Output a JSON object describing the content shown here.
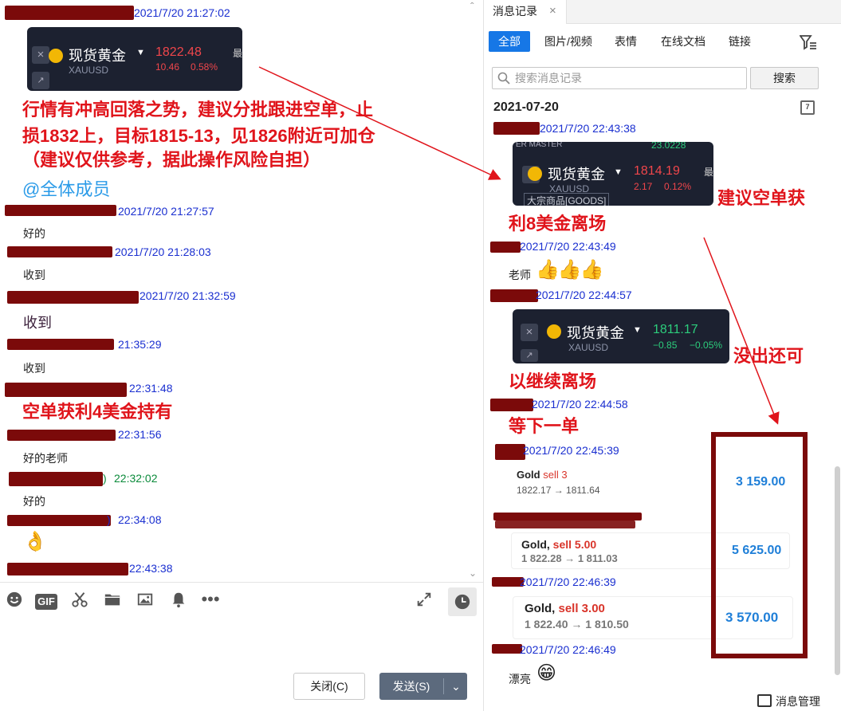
{
  "chat": {
    "entries": [
      {
        "time": "2021/7/20 21:27:02"
      },
      {
        "time": "2021/7/20 21:27:57",
        "text": "好的"
      },
      {
        "time": "2021/7/20 21:28:03",
        "text": "收到"
      },
      {
        "time": "2021/7/20 21:32:59",
        "text": "收到"
      },
      {
        "time": "21:35:29",
        "text": "收到"
      },
      {
        "time": "22:31:48",
        "text": "空单获利4美金持有"
      },
      {
        "time": "22:31:56",
        "text": "好的老师"
      },
      {
        "time": "22:32:02",
        "text": "好的"
      },
      {
        "time": "22:34:08"
      },
      {
        "time": "22:43:38"
      }
    ],
    "ticker": {
      "name": "现货黄金",
      "symbol": "XAUUSD",
      "price": "1822.48",
      "change": "10.46",
      "pct": "0.58%",
      "cut": "最"
    },
    "analysis": [
      "行情有冲高回落之势，建议分批跟进空单，止",
      "损1832上，目标1815-13，见1826附近可加仓",
      "（建议仅供参考，据此操作风险自担）"
    ],
    "mention": "@全体成员",
    "bracket_close": ")",
    "toolbar": {
      "close_label": "关闭(C)",
      "send_label": "发送(S)",
      "gif_label": "GIF"
    }
  },
  "history": {
    "tab_label": "消息记录",
    "filters": [
      "全部",
      "图片/视频",
      "表情",
      "在线文档",
      "链接"
    ],
    "search_placeholder": "搜索消息记录",
    "search_button": "搜索",
    "date_heading": "2021-07-20",
    "calendar_day": "7",
    "ticker1": {
      "header": "ER MASTER",
      "name": "现货黄金",
      "price": "1814.19",
      "change": "2.17",
      "pct": "0.12%",
      "symbol": "XAUUSD",
      "tag": "大宗商品[GOODS]",
      "top_num": "23.0228",
      "cut": "最"
    },
    "ticker2": {
      "name": "现货黄金",
      "symbol": "XAUUSD",
      "price": "1811.17",
      "change": "−0.85",
      "pct": "−0.05%"
    },
    "entries": [
      {
        "time": "2021/7/20 22:43:38"
      },
      {
        "time": "2021/7/20 22:43:49",
        "text": "老师"
      },
      {
        "time": "2021/7/20 22:44:57"
      },
      {
        "time": "2021/7/20 22:44:58"
      },
      {
        "time": "2021/7/20 22:45:39"
      },
      {
        "time": "2021/7/20 22:46:39"
      },
      {
        "time": "2021/7/20 22:46:49",
        "text": "漂亮"
      }
    ],
    "trades": [
      {
        "instrument": "Gold",
        "action": "sell 3",
        "range": "1822.17 → 1811.64",
        "amount": "3 159.00"
      },
      {
        "instrument": "Gold,",
        "action": "sell 5.00",
        "range": "1 822.28 → 1 811.03",
        "amount": "5 625.00"
      },
      {
        "instrument": "Gold,",
        "action": "sell 3.00",
        "range": "1 822.40 → 1 810.50",
        "amount": "3 570.00"
      }
    ],
    "manage_label": "消息管理"
  },
  "annotations": {
    "a1_line1": "建议空单获",
    "a1_line2": "利8美金离场",
    "a2": "没出还可",
    "a3": "以继续离场",
    "a4": "等下一单"
  },
  "colors": {
    "accent": "#1677e6",
    "redact": "#7b0a0a",
    "annotation_red": "#e0141b",
    "timestamp_blue": "#1a2fd0"
  }
}
